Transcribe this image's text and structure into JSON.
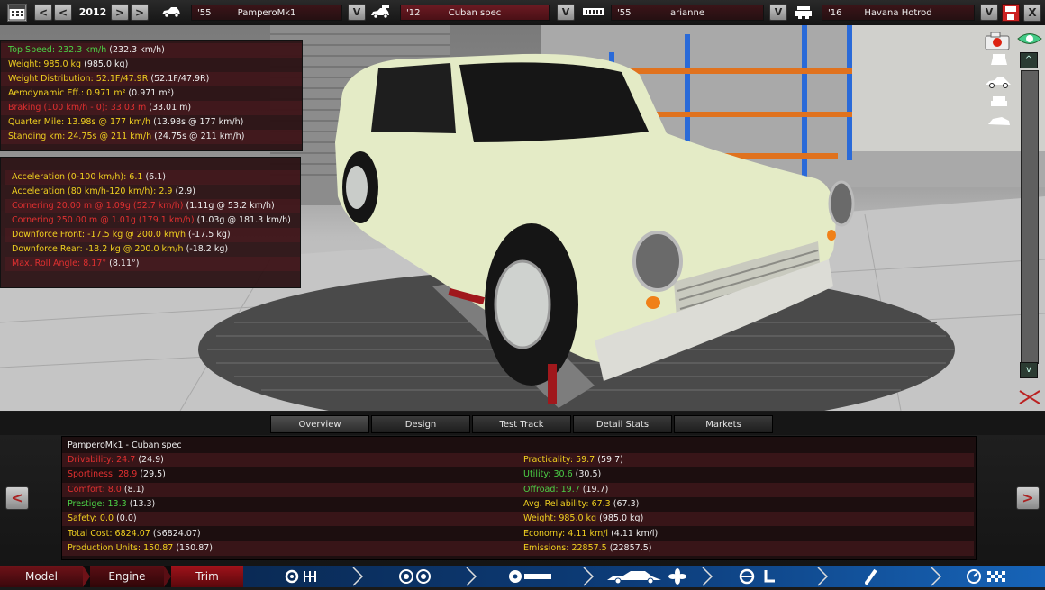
{
  "topbar": {
    "year": "2012",
    "prev_label": "<",
    "next_label": ">",
    "model": {
      "year": "'55",
      "name": "PamperoMk1"
    },
    "trim": {
      "year": "'12",
      "name": "Cuban spec"
    },
    "engine": {
      "year": "'55",
      "name": "arianne"
    },
    "family": {
      "year": "'16",
      "name": "Havana Hotrod"
    },
    "dropdown_label": "V",
    "close_label": "X",
    "accent": "#8b1a22"
  },
  "stats_top": [
    {
      "label": "Top Speed: 232.3 km/h",
      "paren": "(232.3 km/h)",
      "color": "green"
    },
    {
      "label": "Weight: 985.0 kg",
      "paren": "(985.0 kg)",
      "color": "yellow"
    },
    {
      "label": "Weight Distribution: 52.1F/47.9R",
      "paren": "(52.1F/47.9R)",
      "color": "yellow"
    },
    {
      "label": "Aerodynamic Eff.: 0.971 m²",
      "paren": "(0.971 m²)",
      "color": "yellow"
    },
    {
      "label": "Braking (100 km/h - 0): 33.03 m",
      "paren": "(33.01 m)",
      "color": "red"
    },
    {
      "label": "Quarter Mile: 13.98s @ 177 km/h",
      "paren": "(13.98s @ 177 km/h)",
      "color": "yellow"
    },
    {
      "label": "Standing km: 24.75s @ 211 km/h",
      "paren": "(24.75s @ 211 km/h)",
      "color": "yellow"
    }
  ],
  "stats_bottom": [
    {
      "label": "Acceleration (0-100 km/h): 6.1",
      "paren": "(6.1)",
      "color": "yellow"
    },
    {
      "label": "Acceleration (80 km/h-120 km/h): 2.9",
      "paren": "(2.9)",
      "color": "yellow"
    },
    {
      "label": "Cornering 20.00 m @ 1.09g (52.7 km/h)",
      "paren": "(1.11g @ 53.2 km/h)",
      "color": "red"
    },
    {
      "label": "Cornering 250.00 m @ 1.01g (179.1 km/h)",
      "paren": "(1.03g @ 181.3 km/h)",
      "color": "red"
    },
    {
      "label": "Downforce Front: -17.5 kg @ 200.0 km/h",
      "paren": "(-17.5 kg)",
      "color": "yellow"
    },
    {
      "label": "Downforce Rear: -18.2 kg @ 200.0 km/h",
      "paren": "(-18.2 kg)",
      "color": "yellow"
    },
    {
      "label": "Max. Roll Angle: 8.17°",
      "paren": "(8.11°)",
      "color": "red"
    }
  ],
  "tabs": [
    "Overview",
    "Design",
    "Test Track",
    "Detail Stats",
    "Markets"
  ],
  "summary": {
    "title": "PamperoMk1 - Cuban spec",
    "left": [
      {
        "label": "Drivability: 24.7",
        "paren": "(24.9)",
        "color": "red"
      },
      {
        "label": "Sportiness: 28.9",
        "paren": "(29.5)",
        "color": "red"
      },
      {
        "label": "Comfort: 8.0",
        "paren": "(8.1)",
        "color": "red"
      },
      {
        "label": "Prestige: 13.3",
        "paren": "(13.3)",
        "color": "green"
      },
      {
        "label": "Safety: 0.0",
        "paren": "(0.0)",
        "color": "yellow"
      },
      {
        "label": "Total Cost: 6824.07",
        "paren": "($6824.07)",
        "color": "yellow"
      },
      {
        "label": "Production Units: 150.87",
        "paren": "(150.87)",
        "color": "yellow"
      }
    ],
    "right": [
      {
        "label": "Practicality: 59.7",
        "paren": "(59.7)",
        "color": "yellow"
      },
      {
        "label": "Utility: 30.6",
        "paren": "(30.5)",
        "color": "green"
      },
      {
        "label": "Offroad: 19.7",
        "paren": "(19.7)",
        "color": "green"
      },
      {
        "label": "Avg. Reliability: 67.3",
        "paren": "(67.3)",
        "color": "yellow"
      },
      {
        "label": "Weight: 985.0 kg",
        "paren": "(985.0 kg)",
        "color": "yellow"
      },
      {
        "label": "Economy: 4.11 km/l",
        "paren": "(4.11 km/l)",
        "color": "yellow"
      },
      {
        "label": "Emissions: 22857.5",
        "paren": "(22857.5)",
        "color": "yellow"
      }
    ]
  },
  "bottom_nav": {
    "model": "Model",
    "engine": "Engine",
    "trim": "Trim"
  },
  "side": {
    "left_arrow": "<",
    "right_arrow": ">",
    "scroll_up": "^",
    "scroll_down": "v"
  }
}
